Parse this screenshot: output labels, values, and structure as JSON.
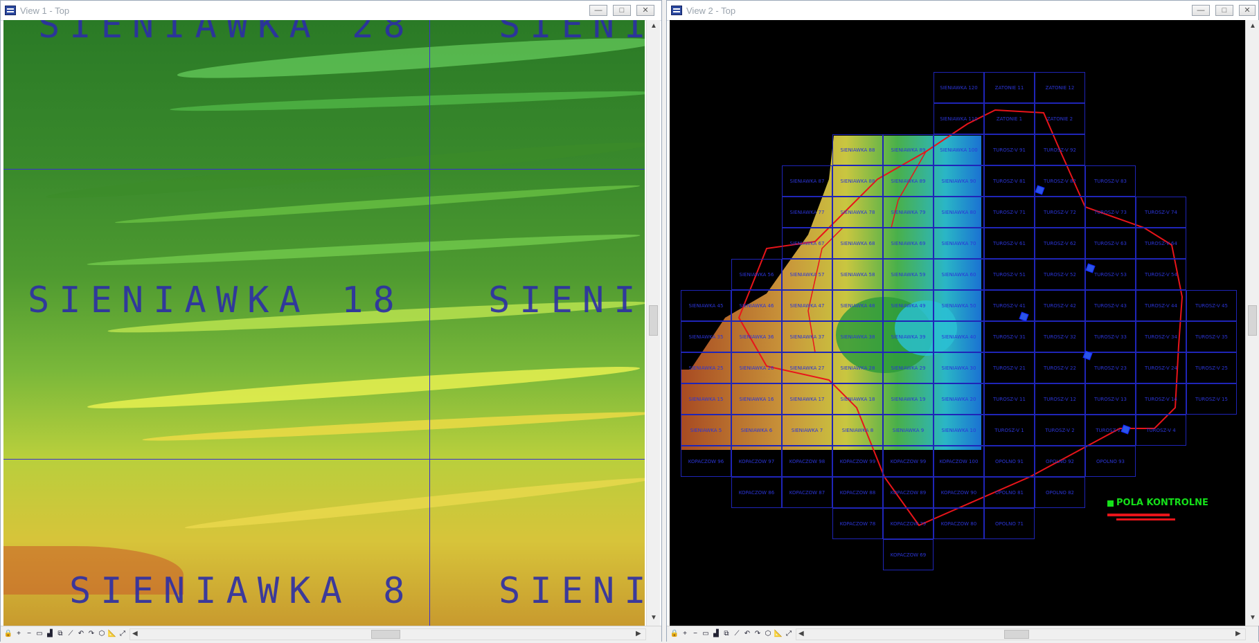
{
  "view1": {
    "title": "View 1 - Top",
    "labels": [
      "SIENIAWKA 28",
      "SIENI",
      "SIENIAWKA 18",
      "SIENIA",
      "SIENIAWKA 8",
      "SIENI"
    ]
  },
  "view2": {
    "title": "View 2 - Top",
    "legend": "POLA KONTROLNE",
    "grid_rows": [
      [
        "",
        "",
        "",
        "",
        "",
        "SIENIAWKA 120",
        "ZATONIE 11",
        "ZATONIE 12",
        "",
        "",
        ""
      ],
      [
        "",
        "",
        "",
        "",
        "",
        "SIENIAWKA 110",
        "ZATONIE 1",
        "ZATONIE 2",
        "",
        "",
        ""
      ],
      [
        "",
        "",
        "",
        "SIENIAWKA 88",
        "SIENIAWKA 89",
        "SIENIAWKA 100",
        "TUROSZ-V 91",
        "TUROSZ-V 92",
        "",
        "",
        ""
      ],
      [
        "",
        "",
        "SIENIAWKA 87",
        "SIENIAWKA 88",
        "SIENIAWKA 89",
        "SIENIAWKA 90",
        "TUROSZ-V 81",
        "TUROSZ-V 82",
        "TUROSZ-V 83",
        "",
        ""
      ],
      [
        "",
        "",
        "SIENIAWKA 77",
        "SIENIAWKA 78",
        "SIENIAWKA 79",
        "SIENIAWKA 80",
        "TUROSZ-V 71",
        "TUROSZ-V 72",
        "TUROSZ-V 73",
        "TUROSZ-V 74",
        ""
      ],
      [
        "",
        "",
        "SIENIAWKA 67",
        "SIENIAWKA 68",
        "SIENIAWKA 69",
        "SIENIAWKA 70",
        "TUROSZ-V 61",
        "TUROSZ-V 62",
        "TUROSZ-V 63",
        "TUROSZ-V 64",
        ""
      ],
      [
        "",
        "SIENIAWKA 56",
        "SIENIAWKA 57",
        "SIENIAWKA 58",
        "SIENIAWKA 59",
        "SIENIAWKA 60",
        "TUROSZ-V 51",
        "TUROSZ-V 52",
        "TUROSZ-V 53",
        "TUROSZ-V 54",
        ""
      ],
      [
        "SIENIAWKA 45",
        "SIENIAWKA 46",
        "SIENIAWKA 47",
        "SIENIAWKA 48",
        "SIENIAWKA 49",
        "SIENIAWKA 50",
        "TUROSZ-V 41",
        "TUROSZ-V 42",
        "TUROSZ-V 43",
        "TUROSZ-V 44",
        "TUROSZ-V 45"
      ],
      [
        "SIENIAWKA 35",
        "SIENIAWKA 36",
        "SIENIAWKA 37",
        "SIENIAWKA 38",
        "SIENIAWKA 39",
        "SIENIAWKA 40",
        "TUROSZ-V 31",
        "TUROSZ-V 32",
        "TUROSZ-V 33",
        "TUROSZ-V 34",
        "TUROSZ-V 35"
      ],
      [
        "SIENIAWKA 25",
        "SIENIAWKA 26",
        "SIENIAWKA 27",
        "SIENIAWKA 28",
        "SIENIAWKA 29",
        "SIENIAWKA 30",
        "TUROSZ-V 21",
        "TUROSZ-V 22",
        "TUROSZ-V 23",
        "TUROSZ-V 24",
        "TUROSZ-V 25"
      ],
      [
        "SIENIAWKA 15",
        "SIENIAWKA 16",
        "SIENIAWKA 17",
        "SIENIAWKA 18",
        "SIENIAWKA 19",
        "SIENIAWKA 20",
        "TUROSZ-V 11",
        "TUROSZ-V 12",
        "TUROSZ-V 13",
        "TUROSZ-V 14",
        "TUROSZ-V 15"
      ],
      [
        "SIENIAWKA 5",
        "SIENIAWKA 6",
        "SIENIAWKA 7",
        "SIENIAWKA 8",
        "SIENIAWKA 9",
        "SIENIAWKA 10",
        "TUROSZ-V 1",
        "TUROSZ-V 2",
        "TUROSZ-V 3",
        "TUROSZ-V 4",
        ""
      ],
      [
        "KOPACZOW 96",
        "KOPACZOW 97",
        "KOPACZOW 98",
        "KOPACZOW 99",
        "KOPACZOW 99",
        "KOPACZOW 100",
        "OPOLNO 91",
        "OPOLNO 92",
        "OPOLNO 93",
        "",
        ""
      ],
      [
        "",
        "KOPACZOW 86",
        "KOPACZOW 87",
        "KOPACZOW 88",
        "KOPACZOW 89",
        "KOPACZOW 90",
        "OPOLNO 81",
        "OPOLNO 82",
        "",
        "",
        ""
      ],
      [
        "",
        "",
        "",
        "KOPACZOW 78",
        "KOPACZOW 79",
        "KOPACZOW 80",
        "OPOLNO 71",
        "",
        "",
        "",
        ""
      ],
      [
        "",
        "",
        "",
        "",
        "KOPACZOW 69",
        "",
        "",
        "",
        "",
        "",
        ""
      ]
    ]
  },
  "window_buttons": {
    "minimize": "—",
    "maximize": "□",
    "close": "✕"
  },
  "scroll_arrows": {
    "up": "▲",
    "down": "▼",
    "left": "◀",
    "right": "▶"
  },
  "toolbar_icons": [
    "lock-icon",
    "plus-icon",
    "minus-icon",
    "window-icon",
    "chart-icon",
    "copy-icon",
    "line-icon",
    "undo-icon",
    "redo-icon",
    "shape-icon",
    "ruler-icon",
    "extent-icon"
  ],
  "toolbar_glyphs": [
    "🔒",
    "+",
    "−",
    "▭",
    "▟",
    "⧉",
    "⟋",
    "↶",
    "↷",
    "⬡",
    "📐",
    "⤢"
  ]
}
